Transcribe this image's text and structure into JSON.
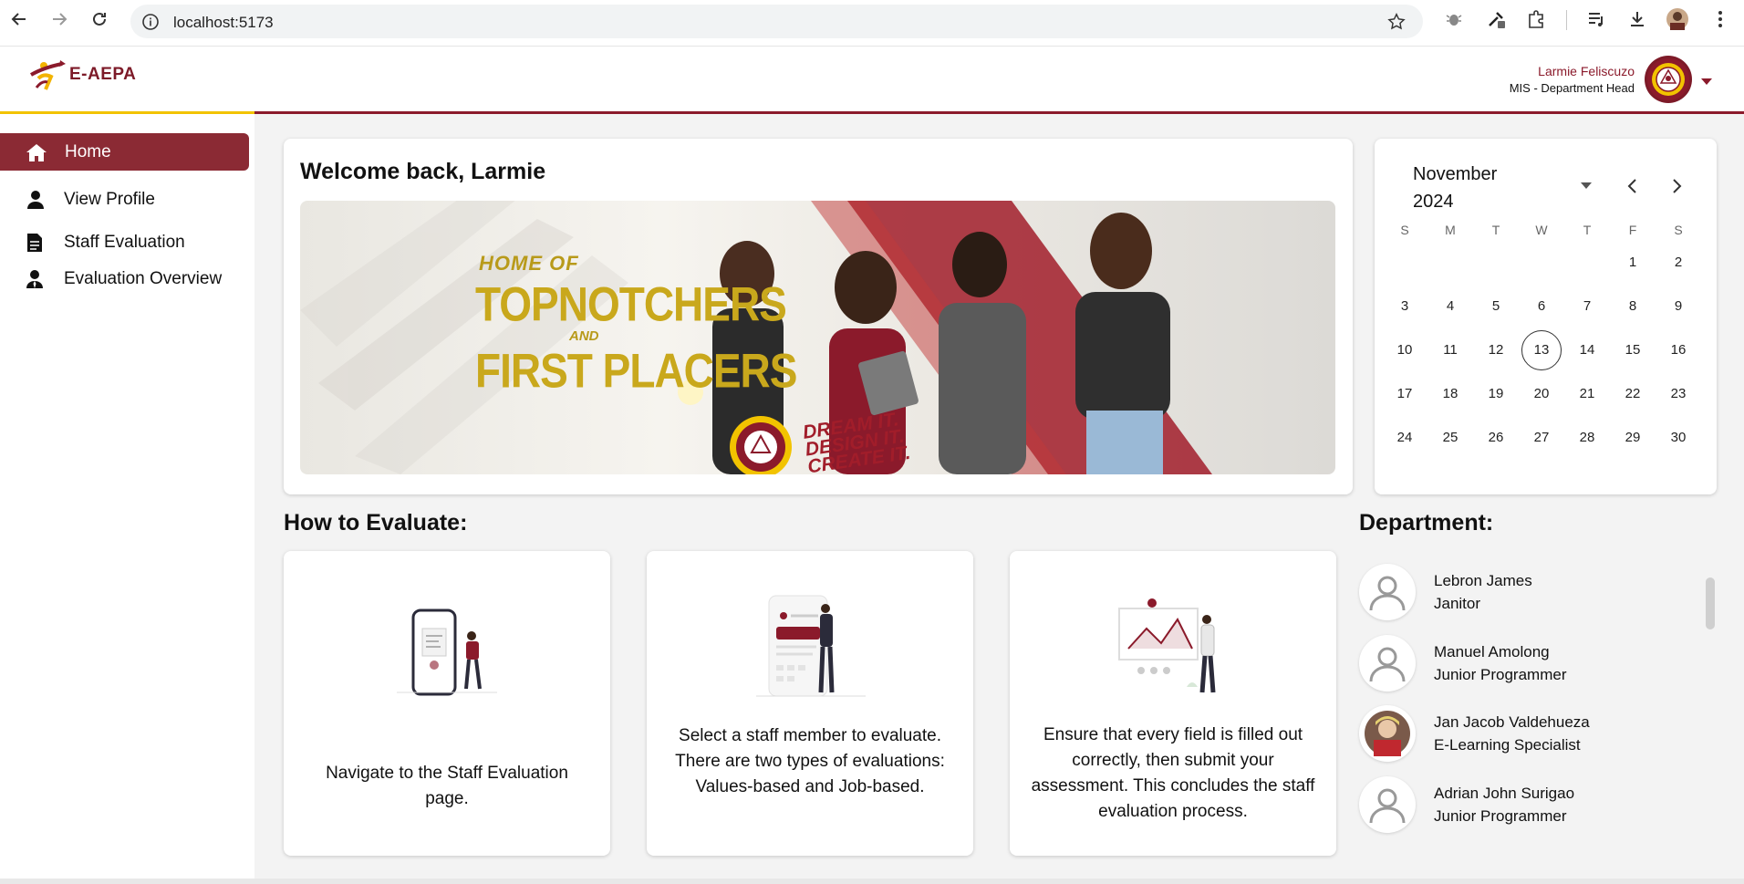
{
  "browser": {
    "url": "localhost:5173"
  },
  "app": {
    "logo_text": "E-AEPA",
    "user_name": "Larmie Feliscuzo",
    "user_role": "MIS - Department Head",
    "brand_color": "#8b1a2b",
    "accent_color": "#f2c300"
  },
  "sidebar": {
    "items": [
      {
        "label": "Home",
        "icon": "home-icon",
        "active": true
      },
      {
        "label": "View Profile",
        "icon": "person-icon",
        "active": false
      },
      {
        "label": "Staff Evaluation",
        "icon": "document-icon",
        "active": false
      },
      {
        "label": "Evaluation Overview",
        "icon": "person-tie-icon",
        "active": false
      }
    ]
  },
  "welcome": {
    "title": "Welcome back, Larmie",
    "banner": {
      "line1": "HOME OF",
      "line2": "TOPNOTCHERS",
      "line3": "AND",
      "line4": "FIRST PLACERS",
      "tagline1": "DREAM IT.",
      "tagline2": "DESIGN IT.",
      "tagline3": "CREATE IT."
    }
  },
  "calendar": {
    "month_label": "November 2024",
    "weekdays": [
      "S",
      "M",
      "T",
      "W",
      "T",
      "F",
      "S"
    ],
    "weeks": [
      [
        "",
        "",
        "",
        "",
        "",
        "1",
        "2"
      ],
      [
        "3",
        "4",
        "5",
        "6",
        "7",
        "8",
        "9"
      ],
      [
        "10",
        "11",
        "12",
        "13",
        "14",
        "15",
        "16"
      ],
      [
        "17",
        "18",
        "19",
        "20",
        "21",
        "22",
        "23"
      ],
      [
        "24",
        "25",
        "26",
        "27",
        "28",
        "29",
        "30"
      ]
    ],
    "today": "13"
  },
  "how_to": {
    "title": "How to Evaluate:",
    "steps": [
      {
        "text": "Navigate to the Staff Evaluation page."
      },
      {
        "text": "Select a staff member to evaluate. There are two types of evaluations: Values-based and Job-based."
      },
      {
        "text": "Ensure that every field is filled out correctly, then submit your assessment. This concludes the staff evaluation process."
      }
    ]
  },
  "department": {
    "title": "Department:",
    "members": [
      {
        "name": "Lebron James",
        "role": "Janitor"
      },
      {
        "name": "Manuel Amolong",
        "role": "Junior Programmer"
      },
      {
        "name": "Jan Jacob Valdehueza",
        "role": "E-Learning Specialist"
      },
      {
        "name": "Adrian John Surigao",
        "role": "Junior Programmer"
      }
    ]
  }
}
